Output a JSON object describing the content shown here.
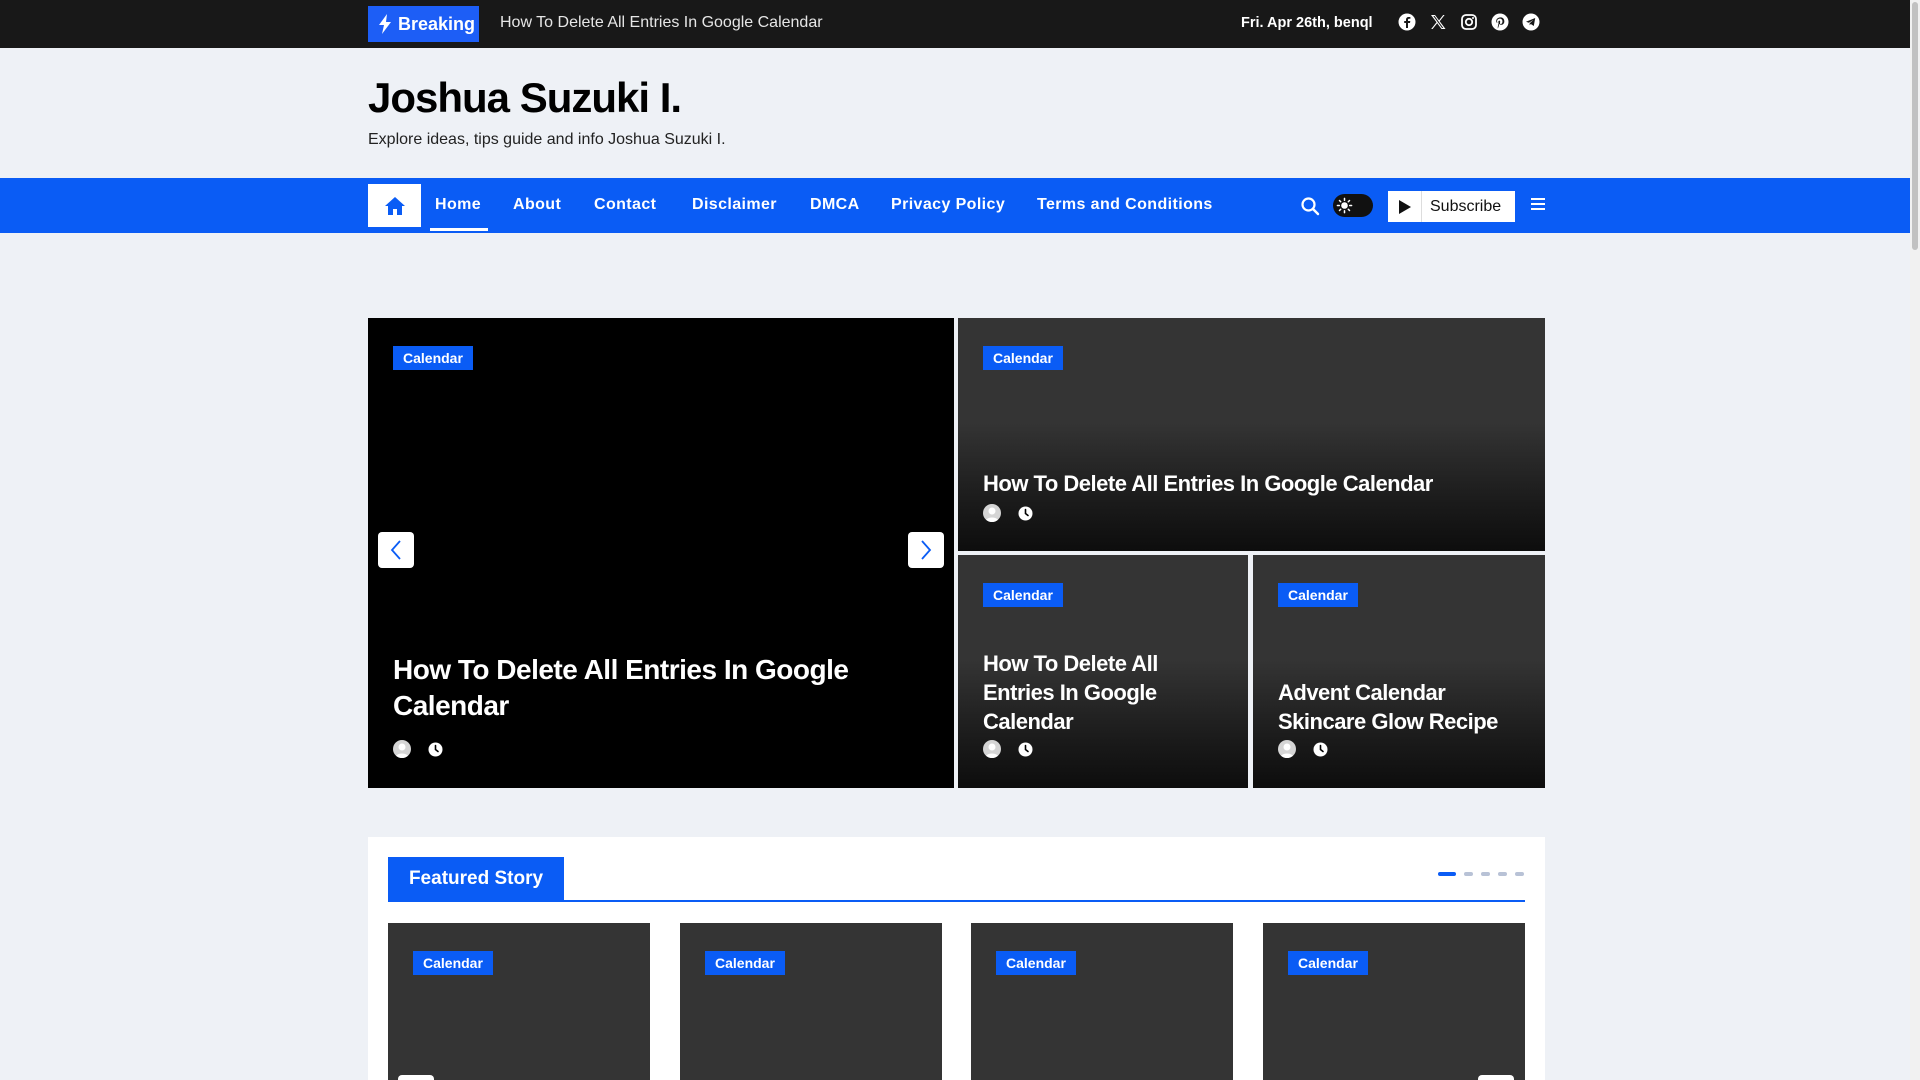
{
  "topbar": {
    "breaking_label": "Breaking",
    "ticker_text": "How To Delete All Entries In Google Calendar",
    "date_text": "Fri. Apr 26th, benql",
    "socials": [
      "facebook-icon",
      "x-icon",
      "instagram-icon",
      "pinterest-icon",
      "telegram-icon"
    ]
  },
  "header": {
    "site_title": "Joshua Suzuki I.",
    "tagline": "Explore ideas, tips guide and info Joshua Suzuki I."
  },
  "nav": {
    "items": [
      "Home",
      "About",
      "Contact",
      "Disclaimer",
      "DMCA",
      "Privacy Policy",
      "Terms and Conditions"
    ],
    "active": "Home",
    "subscribe_label": "Subscribe"
  },
  "hero": {
    "main": {
      "category": "Calendar",
      "title": "How To Delete All Entries In Google Calendar"
    },
    "top_right": {
      "category": "Calendar",
      "title": "How To Delete All Entries In Google Calendar"
    },
    "bottom_left": {
      "category": "Calendar",
      "title": "How To Delete All Entries In Google Calendar"
    },
    "bottom_right": {
      "category": "Calendar",
      "title": "Advent Calendar Skincare Glow Recipe"
    }
  },
  "featured": {
    "heading": "Featured Story",
    "slide_count": 5,
    "active_slide": 1,
    "cards": [
      {
        "category": "Calendar"
      },
      {
        "category": "Calendar"
      },
      {
        "category": "Calendar"
      },
      {
        "category": "Calendar"
      }
    ]
  },
  "colors": {
    "accent": "#0a5cf5",
    "topbar": "#181818",
    "page_bg": "#eef1f6"
  }
}
